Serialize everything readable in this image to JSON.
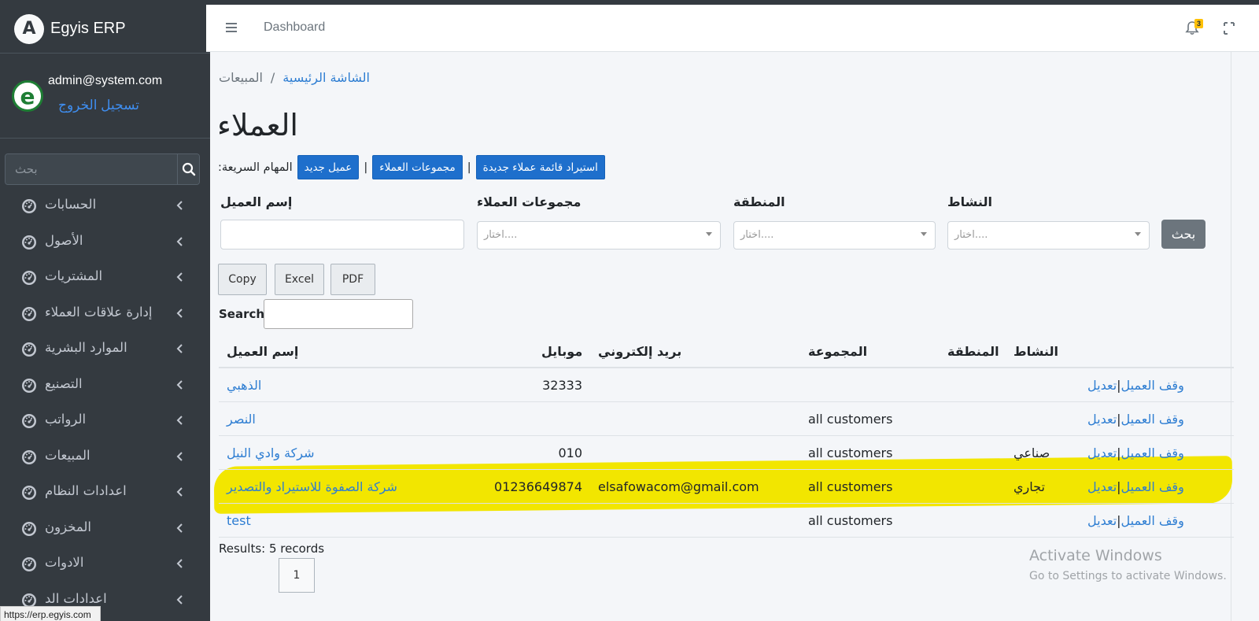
{
  "app": {
    "brand": "Egyis ERP",
    "brand_logo_letter": "A"
  },
  "user": {
    "email": "admin@system.com",
    "logout": "تسجيل الخروج",
    "avatar_letter": "e"
  },
  "sidebar": {
    "search_placeholder": "بحث",
    "items": [
      {
        "label": "الحسابات"
      },
      {
        "label": "الأصول"
      },
      {
        "label": "المشتريات"
      },
      {
        "label": "إدارة علاقات العملاء"
      },
      {
        "label": "الموارد البشرية"
      },
      {
        "label": "التصنيع"
      },
      {
        "label": "الرواتب"
      },
      {
        "label": "المبيعات"
      },
      {
        "label": "اعدادات النظام"
      },
      {
        "label": "المخزون"
      },
      {
        "label": "الادوات"
      },
      {
        "label": "اعدادات الد"
      }
    ],
    "status_url": "https://erp.egyis.com"
  },
  "header": {
    "dashboard_link": "Dashboard",
    "notification_count": "3"
  },
  "breadcrumb": {
    "home": "الشاشة الرئيسية",
    "separator": "/",
    "current": "المبيعات"
  },
  "page": {
    "title": "العملاء"
  },
  "quick_tasks": {
    "label": ":المهام السريعة",
    "new_customer": "عميل جديد",
    "customer_groups": "مجموعات العملاء",
    "import_list": "استيراد قائمة عملاء جديدة",
    "separator": "|"
  },
  "filters": {
    "customer_name_label": "إسم العميل",
    "groups_label": "مجموعات العملاء",
    "region_label": "المنطقة",
    "activity_label": "النشاط",
    "select_placeholder": "اختار....",
    "search_button": "بحث"
  },
  "export": {
    "copy": "Copy",
    "excel": "Excel",
    "pdf": "PDF"
  },
  "table_search": {
    "label": "Search:"
  },
  "table": {
    "headers": {
      "name": "إسم العميل",
      "mobile": "موبايل",
      "email": "بريد إلكتروني",
      "group": "المجموعة",
      "region": "المنطقة",
      "activity": "النشاط"
    },
    "action_edit": "تعديل",
    "action_sep": "|",
    "action_stop": "وقف العميل",
    "rows": [
      {
        "name": "الذهبي",
        "mobile": "32333",
        "email": "",
        "group": "",
        "region": "",
        "activity": ""
      },
      {
        "name": "النصر",
        "mobile": "",
        "email": "",
        "group": "all customers",
        "region": "",
        "activity": ""
      },
      {
        "name": "شركة وادي النيل",
        "mobile": "010",
        "email": "",
        "group": "all customers",
        "region": "",
        "activity": "صناعي"
      },
      {
        "name": "شركة الصفوة للاستيراد والتصدير",
        "mobile": "01236649874",
        "email": "elsafowacom@gmail.com",
        "group": "all customers",
        "region": "",
        "activity": "تجاري"
      },
      {
        "name": "test",
        "mobile": "",
        "email": "",
        "group": "all customers",
        "region": "",
        "activity": ""
      }
    ]
  },
  "results": {
    "text": "Results: 5 records",
    "page": "1"
  },
  "watermark": {
    "title": "Activate Windows",
    "subtitle": "Go to Settings to activate Windows."
  },
  "colors": {
    "sidebar_bg": "#343a40",
    "primary": "#1e6fcc",
    "link": "#2d7dd2",
    "highlight": "#f2e600",
    "secondary": "#6c757d"
  }
}
